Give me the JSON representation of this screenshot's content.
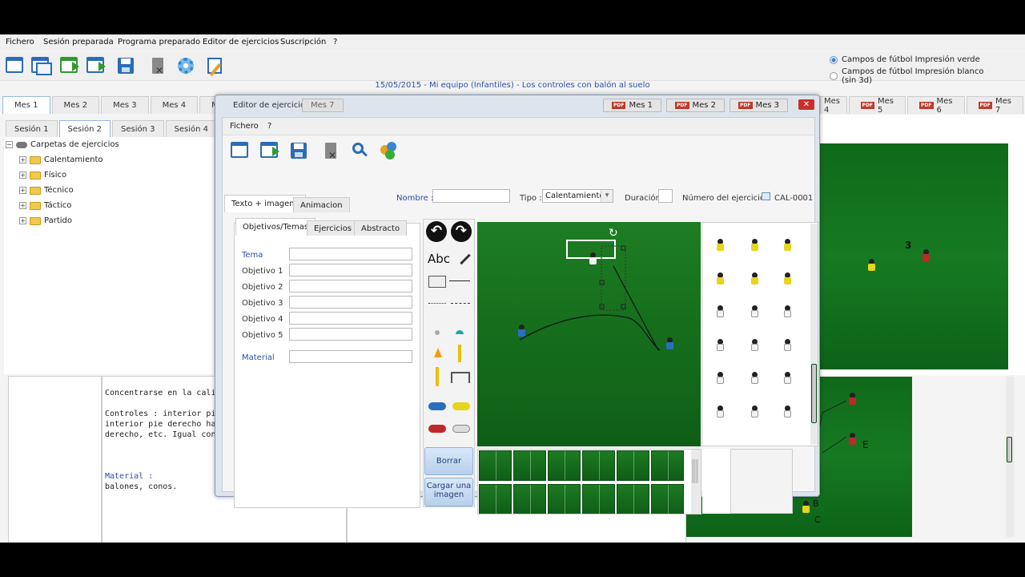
{
  "menu": [
    "Fichero",
    "Sesión preparada",
    "Programa preparado",
    "Editor de ejercicios",
    "Suscripción",
    "?"
  ],
  "toolbar_icons": [
    "new-window-icon",
    "windows-icon",
    "export-icon",
    "import-icon",
    "save-icon",
    "delete-icon",
    "settings-icon",
    "edit-icon"
  ],
  "print_options": {
    "green": "Campos de fútbol Impresión verde",
    "white": "Campos de fútbol Impresión blanco (sin 3d)",
    "selected": "green"
  },
  "session_title": "15/05/2015 - Mi equipo (Infantiles) - Los controles con balón al suelo",
  "month_tabs_left": [
    "Mes 1",
    "Mes 2",
    "Mes 3",
    "Mes 4",
    "Mes 5"
  ],
  "month_tabs_right": [
    "Mes 4",
    "Mes 5",
    "Mes 6",
    "Mes 7"
  ],
  "session_tabs": [
    "Sesión 1",
    "Sesión 2",
    "Sesión 3",
    "Sesión 4",
    "Se"
  ],
  "tree": {
    "root": "Carpetas de ejercicios",
    "items": [
      "Calentamiento",
      "Físico",
      "Técnico",
      "Táctico",
      "Partido"
    ]
  },
  "lower_text": {
    "line1": "Concentrarse en la calida",
    "line2": "Controles : interior pie de",
    "line3": "interior pie derecho hacia",
    "line4": "derecho, etc. Igual con el",
    "material_label": "Material :",
    "material_value": "balones, conos."
  },
  "field_letters": [
    "3",
    "E",
    "B",
    "C"
  ],
  "dialog": {
    "title": "Editor de ejercicios",
    "behind_tabs": [
      "Mes 7"
    ],
    "pdf_tabs": [
      "Mes 1",
      "Mes 2",
      "Mes 3"
    ],
    "pdf_badge": "PDF",
    "menu": [
      "Fichero",
      "?"
    ],
    "tabs": [
      "Texto + imagen*",
      "Animacion"
    ],
    "name_label": "Nombre :",
    "name_value": "",
    "type_label": "Tipo :",
    "type_value": "Calentamiento",
    "duration_label": "Duración",
    "duration_value": "",
    "exercise_number_label": "Número del ejercicio :",
    "exercise_number_value": "CAL-0001",
    "subtabs": [
      "Objetivos/Temas",
      "Ejercicios",
      "Abstracto"
    ],
    "fields": [
      {
        "label": "Tema",
        "value": ""
      },
      {
        "label": "Objetivo 1",
        "value": ""
      },
      {
        "label": "Objetivo 2",
        "value": ""
      },
      {
        "label": "Objetivo 3",
        "value": ""
      },
      {
        "label": "Objetivo 4",
        "value": ""
      },
      {
        "label": "Objetivo 5",
        "value": ""
      },
      {
        "label": "Material",
        "value": ""
      }
    ],
    "text_tool": "Abc",
    "clear_button": "Borrar todos",
    "load_image_button": "Cargar una imagen"
  }
}
